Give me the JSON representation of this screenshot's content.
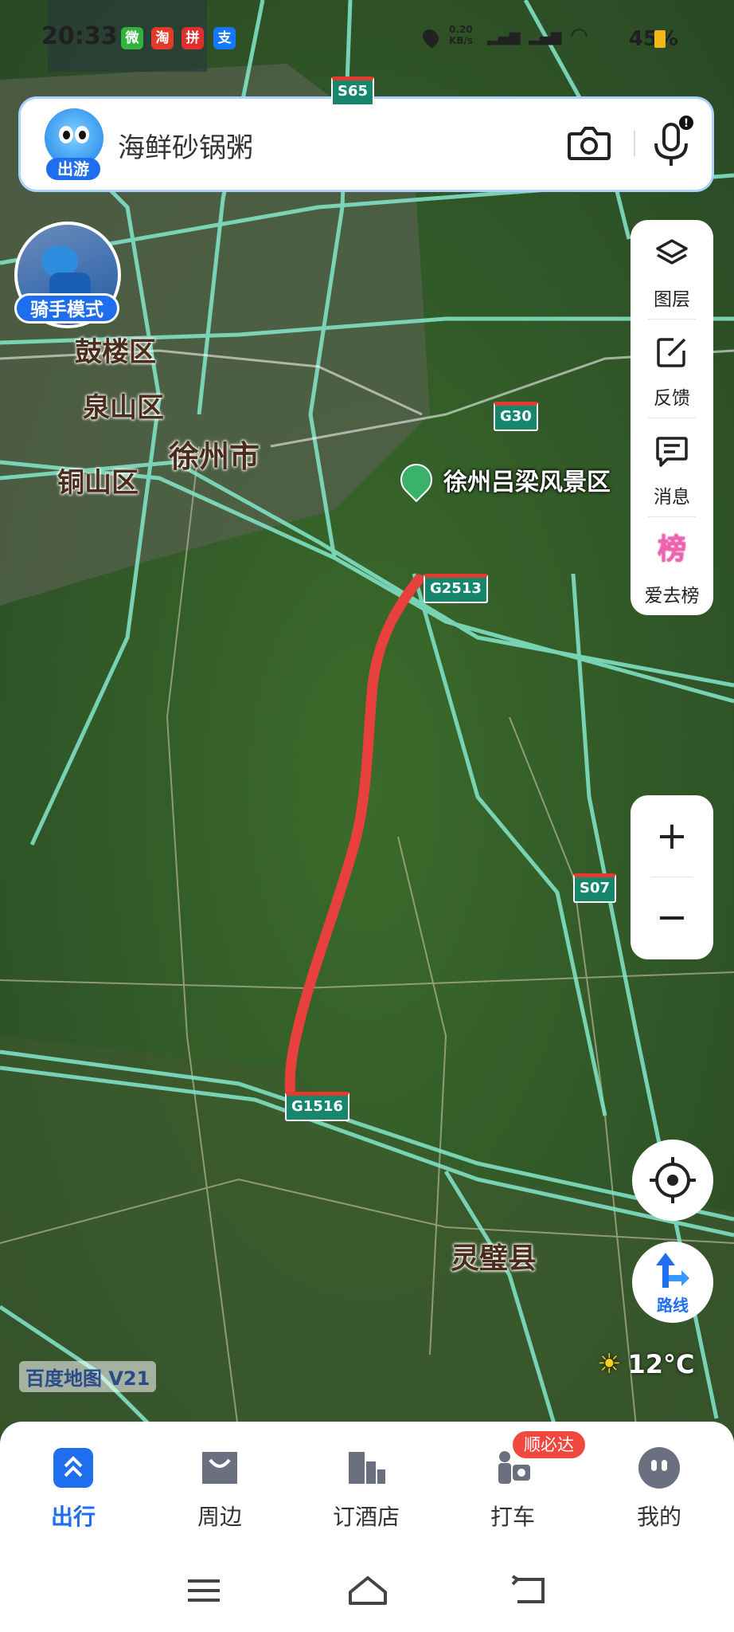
{
  "status_bar": {
    "time": "20:33",
    "apps": [
      "微",
      "淘",
      "拼",
      "支"
    ],
    "network": "0.20 KB/s",
    "battery": "45%"
  },
  "search": {
    "mascot_tag": "出游",
    "query": "海鲜砂锅粥"
  },
  "rider": {
    "label": "骑手模式"
  },
  "side_panel": {
    "items": [
      {
        "label": "图层",
        "icon": "layers-icon"
      },
      {
        "label": "反馈",
        "icon": "feedback-icon"
      },
      {
        "label": "消息",
        "icon": "message-icon"
      },
      {
        "label": "爱去榜",
        "icon": "ranking-icon",
        "glyph": "榜"
      }
    ]
  },
  "zoom": {
    "in": "+",
    "out": "−"
  },
  "route_button": {
    "label": "路线"
  },
  "map": {
    "place_labels": [
      "鼓楼区",
      "泉山区",
      "徐州市",
      "铜山区",
      "灵璧县"
    ],
    "poi": "徐州吕梁风景区",
    "road_shields": [
      "S65",
      "G30",
      "G2513",
      "S07",
      "G1516"
    ],
    "route_color": "#e8403c",
    "road_color": "#7fe0c4"
  },
  "logo": "百度地图 V21",
  "weather": {
    "temp": "12°C"
  },
  "bottom_nav": {
    "tabs": [
      {
        "label": "出行",
        "active": true
      },
      {
        "label": "周边"
      },
      {
        "label": "订酒店"
      },
      {
        "label": "打车"
      },
      {
        "label": "我的"
      }
    ],
    "taxi_badge": "顺必达"
  },
  "colors": {
    "accent": "#1f6ef0",
    "badge": "#f0483e"
  }
}
